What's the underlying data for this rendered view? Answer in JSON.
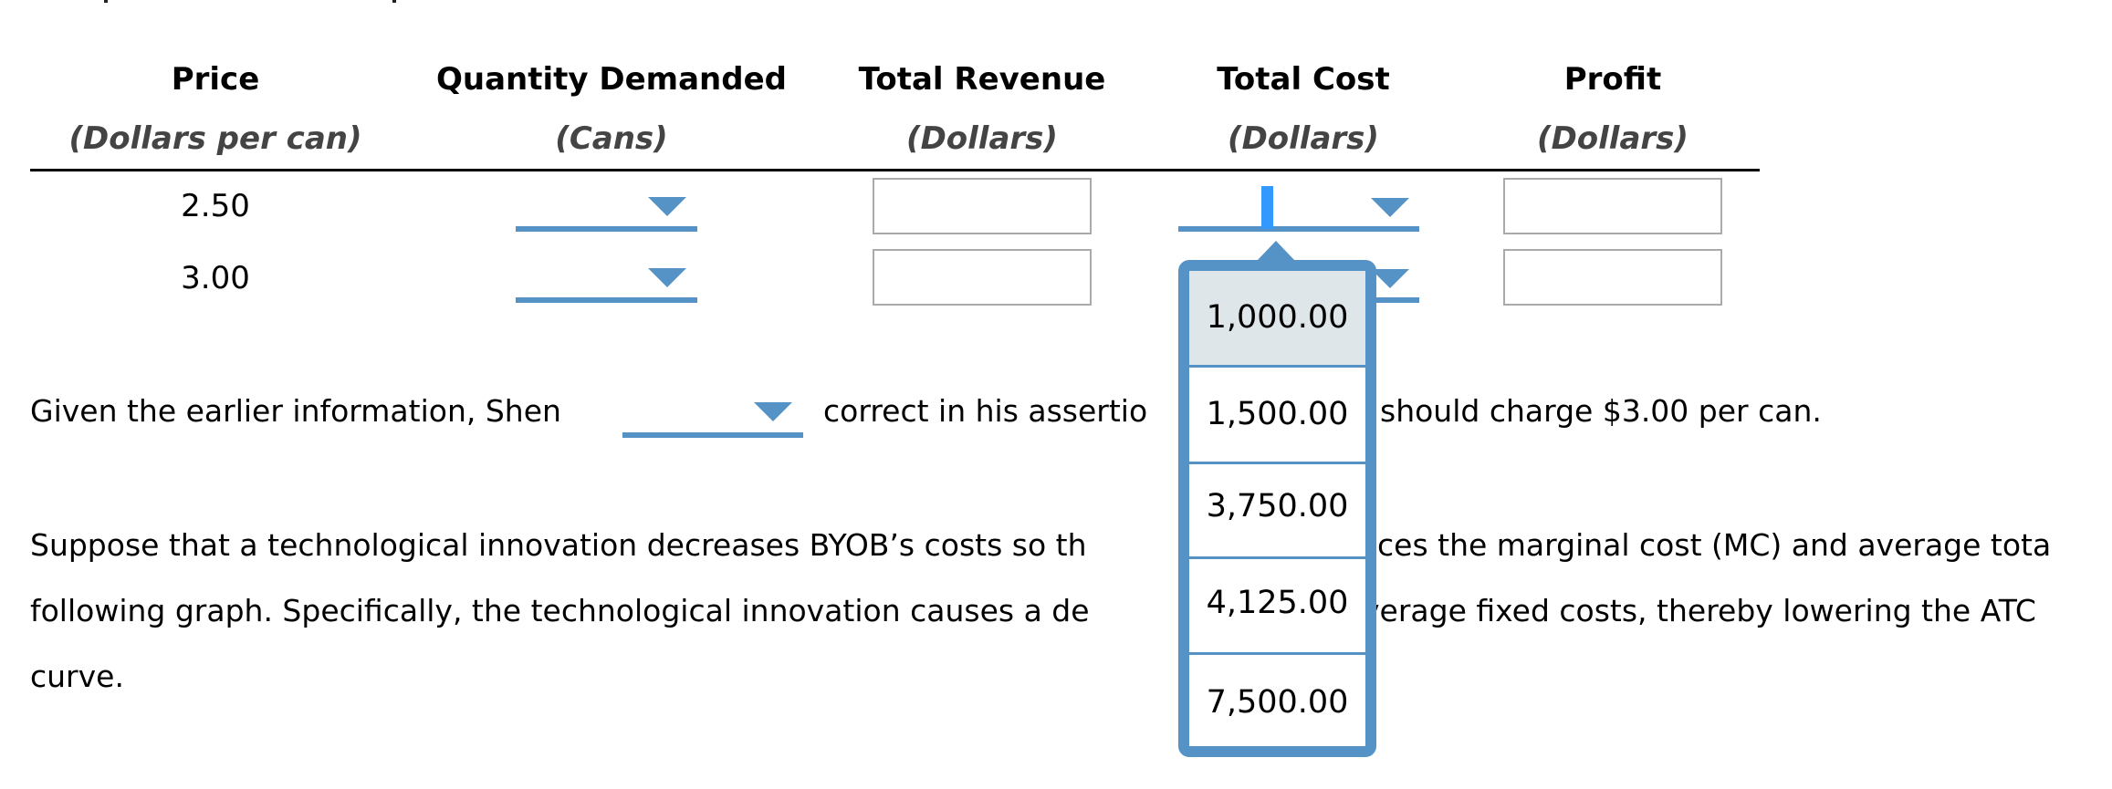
{
  "table": {
    "columns": [
      {
        "title": "Price",
        "unit": "(Dollars per can)"
      },
      {
        "title": "Quantity Demanded",
        "unit": "(Cans)"
      },
      {
        "title": "Total Revenue",
        "unit": "(Dollars)"
      },
      {
        "title": "Total Cost",
        "unit": "(Dollars)"
      },
      {
        "title": "Profit",
        "unit": "(Dollars)"
      }
    ],
    "rows": [
      {
        "price": "2.50",
        "quantity_demanded": "",
        "total_revenue": "",
        "total_cost": "",
        "profit": ""
      },
      {
        "price": "3.00",
        "quantity_demanded": "",
        "total_revenue": "",
        "total_cost": "",
        "profit": ""
      }
    ]
  },
  "sentence": {
    "before": "Given the earlier information, Shen",
    "dropdown_value": "",
    "after_left": "correct in his assertio",
    "after_right": "should charge $3.00 per can."
  },
  "paragraph": {
    "line1_left": "Suppose that a technological innovation decreases BYOB’s costs so th",
    "line1_right": "ces the marginal cost (MC) and average tota",
    "line2_left": "following graph. Specifically, the technological innovation causes a de",
    "line2_right": "verage fixed costs, thereby lowering the ATC",
    "line3": "curve."
  },
  "total_cost_dropdown": {
    "open": true,
    "highlighted_index": 0,
    "options": [
      "1,000.00",
      "1,500.00",
      "3,750.00",
      "4,125.00",
      "7,500.00"
    ]
  },
  "colors": {
    "accent": "#5593c7",
    "highlight": "#dfe6ea",
    "text_cursor": "#3399ff",
    "input_border": "#aaaaaa"
  },
  "icons": {
    "dropdown_arrow": "chevron-down-icon",
    "popup_caret": "caret-up-icon"
  }
}
